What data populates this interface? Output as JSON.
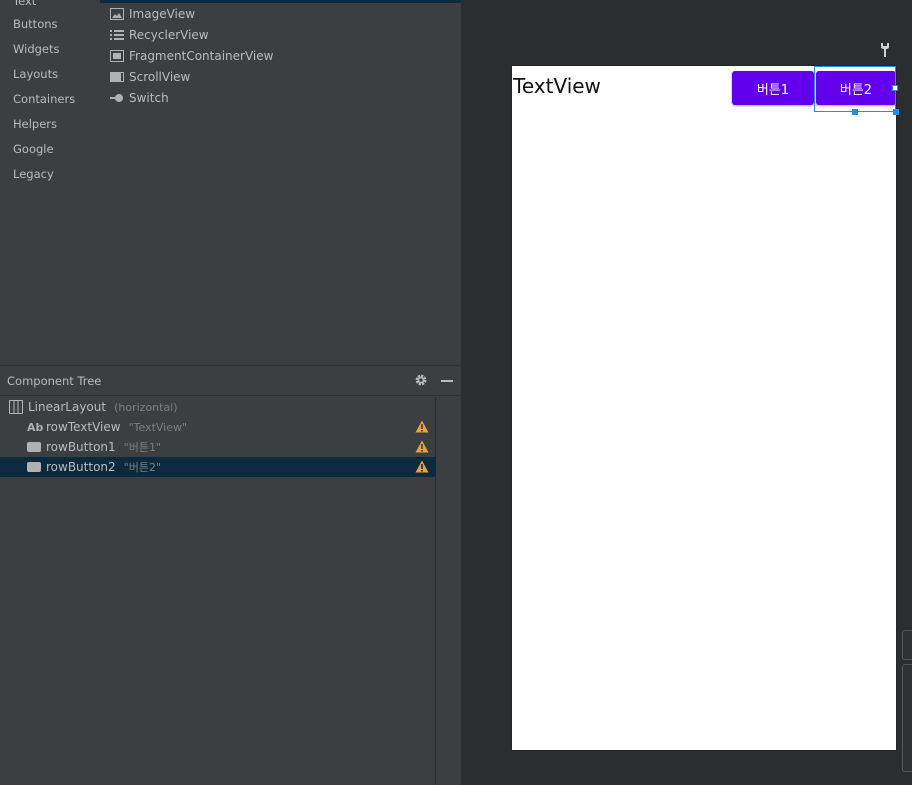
{
  "palette": {
    "categories": [
      "Text",
      "Buttons",
      "Widgets",
      "Layouts",
      "Containers",
      "Helpers",
      "Google",
      "Legacy"
    ],
    "items": [
      "ImageView",
      "RecyclerView",
      "FragmentContainerView",
      "ScrollView",
      "Switch"
    ]
  },
  "component_tree": {
    "title": "Component Tree",
    "rows": [
      {
        "name": "LinearLayout",
        "detail": "(horizontal)",
        "icon": "linear-layout-icon",
        "warning": false,
        "selected": false
      },
      {
        "name": "rowTextView",
        "detail": "\"TextView\"",
        "icon": "textview-icon",
        "icon_text": "Ab",
        "warning": true,
        "selected": false
      },
      {
        "name": "rowButton1",
        "detail": "\"버튼1\"",
        "icon": "button-icon",
        "warning": true,
        "selected": false
      },
      {
        "name": "rowButton2",
        "detail": "\"버튼2\"",
        "icon": "button-icon",
        "warning": true,
        "selected": true
      }
    ]
  },
  "preview": {
    "textview": "TextView",
    "button1": "버튼1",
    "button2": "버튼2",
    "button_color": "#6200ee",
    "selection_color": "#1e8ef5"
  },
  "colors": {
    "panel_bg": "#3c3f41",
    "selected_row": "#0d293e",
    "warning": "#e8a33d"
  }
}
